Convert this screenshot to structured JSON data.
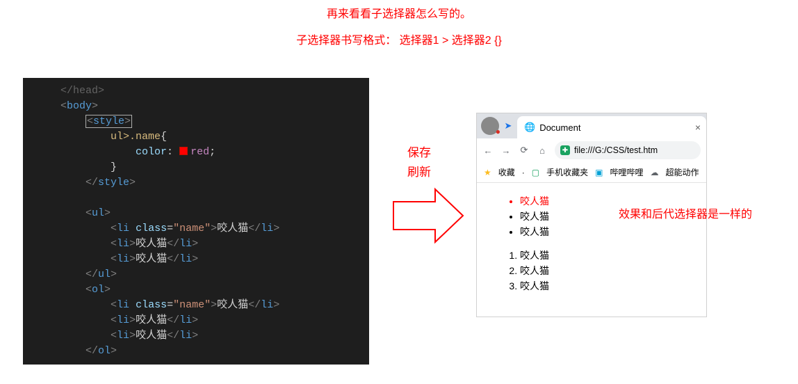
{
  "heading": "再来看看子选择器怎么写的。",
  "subheading": "子选择器书写格式：  选择器1  >  选择器2 {}",
  "mid_label_line1": "保存",
  "mid_label_line2": "刷新",
  "right_note": "效果和后代选择器是一样的",
  "editor": {
    "lines": [
      {
        "indent": 1,
        "raw": [
          "head_close"
        ]
      },
      {
        "indent": 1,
        "raw": [
          "body_open"
        ]
      },
      {
        "indent": 2,
        "raw": [
          "style_open_boxed"
        ]
      },
      {
        "indent": 3,
        "css_sel": "ul>.name",
        "brace": "{"
      },
      {
        "indent": 4,
        "css_prop": "color",
        "css_hasbox": true,
        "css_val": "red",
        "semi": ";"
      },
      {
        "indent": 3,
        "brace": "}"
      },
      {
        "indent": 2,
        "raw": [
          "style_close"
        ]
      },
      {
        "indent": 0,
        "blank": true
      },
      {
        "indent": 2,
        "raw": [
          "ul_open"
        ]
      },
      {
        "indent": 3,
        "tag": "li",
        "attr": "class",
        "attrval": "name",
        "text": "咬人猫"
      },
      {
        "indent": 3,
        "tag": "li",
        "text": "咬人猫"
      },
      {
        "indent": 3,
        "tag": "li",
        "text": "咬人猫"
      },
      {
        "indent": 2,
        "raw": [
          "ul_close"
        ]
      },
      {
        "indent": 2,
        "raw": [
          "ol_open"
        ]
      },
      {
        "indent": 3,
        "tag": "li",
        "attr": "class",
        "attrval": "name",
        "text": "咬人猫"
      },
      {
        "indent": 3,
        "tag": "li",
        "text": "咬人猫"
      },
      {
        "indent": 3,
        "tag": "li",
        "text": "咬人猫"
      },
      {
        "indent": 2,
        "raw": [
          "ol_close"
        ]
      }
    ]
  },
  "browser": {
    "tab_title": "Document",
    "url": "file:///G:/CSS/test.htm",
    "bookmarks": {
      "fav": "收藏",
      "phone": "手机收藏夹",
      "bili": "哔哩哔哩",
      "chao": "超能动作"
    },
    "list_items": [
      "咬人猫",
      "咬人猫",
      "咬人猫"
    ],
    "ol_items": [
      "咬人猫",
      "咬人猫",
      "咬人猫"
    ]
  }
}
